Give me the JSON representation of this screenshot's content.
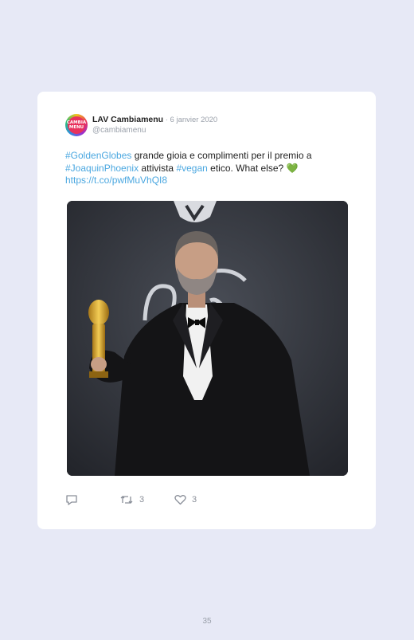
{
  "tweet": {
    "avatar_text": "CAMBIA MENU",
    "author_name": "LAV Cambiamenu",
    "separator": " · ",
    "date": "6 janvier 2020",
    "handle": "@cambiamenu",
    "text": {
      "hashtag_1": "#GoldenGlobes",
      "part_1": " grande gioia e complimenti per il premio a ",
      "hashtag_2": "#JoaquinPhoenix",
      "part_2": " attivista ",
      "hashtag_3": "#vegan",
      "part_3": " etico. What else? ",
      "emoji": "💚",
      "link": "https://t.co/pwfMuVhQI8"
    },
    "actions": {
      "reply_icon": "reply-icon",
      "retweet_icon": "retweet-icon",
      "retweet_count": "3",
      "like_icon": "heart-icon",
      "like_count": "3"
    }
  },
  "page_number": "35",
  "colors": {
    "background": "#e7e9f6",
    "card": "#ffffff",
    "link": "#4aa7e0",
    "muted": "#9aa0aa"
  }
}
